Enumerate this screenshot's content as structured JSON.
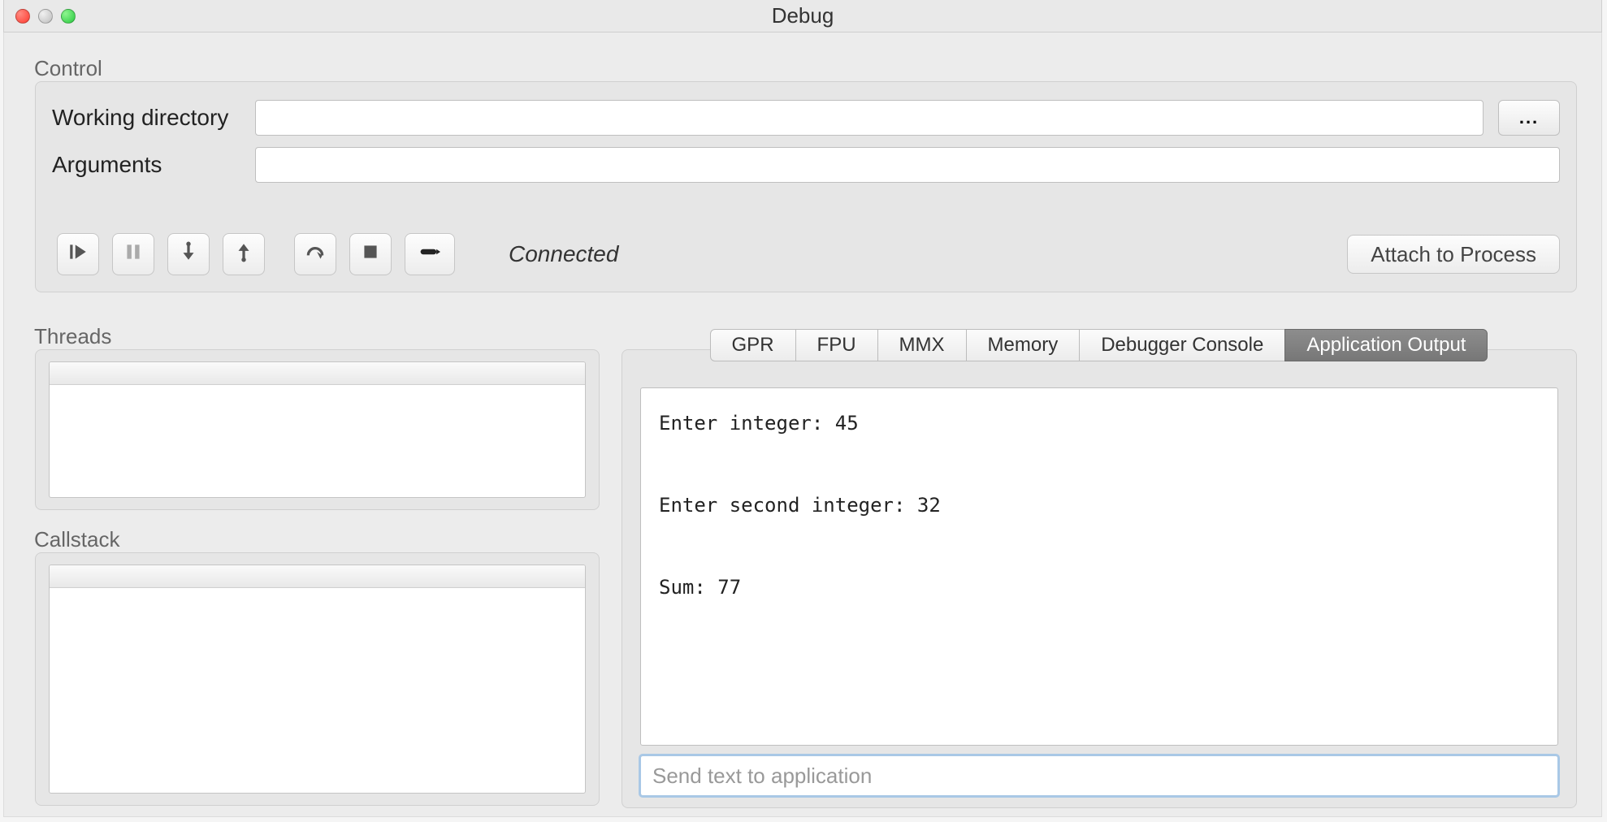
{
  "window": {
    "title": "Debug"
  },
  "control": {
    "group_label": "Control",
    "working_dir_label": "Working directory",
    "working_dir_value": "",
    "browse_label": "...",
    "arguments_label": "Arguments",
    "arguments_value": "",
    "status": "Connected",
    "attach_label": "Attach to Process",
    "buttons": {
      "run": "run",
      "pause": "pause",
      "step_into": "step-into",
      "step_out": "step-out",
      "step_over": "step-over",
      "stop": "stop",
      "breakpoint": "breakpoint"
    }
  },
  "threads": {
    "label": "Threads"
  },
  "callstack": {
    "label": "Callstack"
  },
  "tabs": {
    "items": [
      {
        "label": "GPR"
      },
      {
        "label": "FPU"
      },
      {
        "label": "MMX"
      },
      {
        "label": "Memory"
      },
      {
        "label": "Debugger Console"
      },
      {
        "label": "Application Output"
      }
    ],
    "active_index": 5
  },
  "app_output": {
    "lines": [
      "Enter integer: 45",
      "Enter second integer: 32",
      "Sum: 77"
    ]
  },
  "send": {
    "placeholder": "Send text to application",
    "value": ""
  }
}
